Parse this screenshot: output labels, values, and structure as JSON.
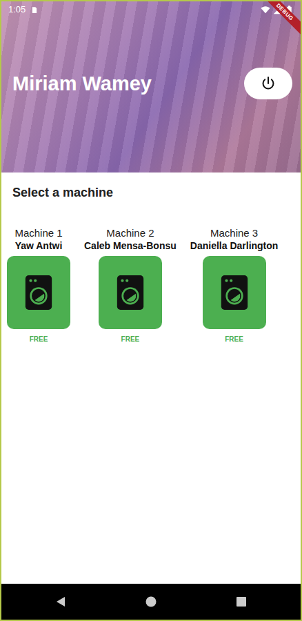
{
  "status_bar": {
    "time": "1:05"
  },
  "debug_banner": "DEBUG",
  "header": {
    "user_name": "Miriam Wamey"
  },
  "section_title": "Select a machine",
  "machines": [
    {
      "label": "Machine 1",
      "user": "Yaw Antwi",
      "status": "FREE",
      "color": "#4caf50"
    },
    {
      "label": "Machine 2",
      "user": "Caleb Mensa-Bonsu",
      "status": "FREE",
      "color": "#4caf50"
    },
    {
      "label": "Machine 3",
      "user": "Daniella Darlington",
      "status": "FREE",
      "color": "#4caf50"
    }
  ]
}
